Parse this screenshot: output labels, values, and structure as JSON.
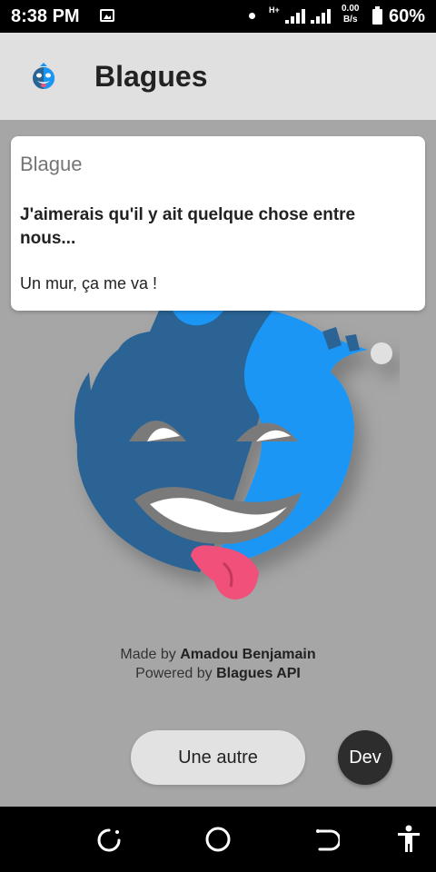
{
  "status_bar": {
    "time": "8:38 PM",
    "network": "H+",
    "speed_value": "0.00",
    "speed_unit": "B/s",
    "battery": "60%"
  },
  "app_bar": {
    "title": "Blagues",
    "logo_icon": "blague-mascot-icon"
  },
  "card": {
    "header": "Blague",
    "setup": "J'aimerais qu'il y ait quelque chose entre nous...",
    "punchline": "Un mur, ça me va !"
  },
  "credits": {
    "made_by_prefix": "Made by",
    "author": "Amadou Benjamain",
    "powered_by_prefix": "Powered by",
    "api": "Blagues API"
  },
  "buttons": {
    "another": "Une autre",
    "dev": "Dev"
  },
  "colors": {
    "light_blue": "#1a96f5",
    "dark_blue": "#2a6494",
    "tongue": "#f0507a",
    "background": "#a6a6a6"
  },
  "nav_bar": {
    "icons": [
      "recent-apps-icon",
      "home-icon",
      "back-icon",
      "accessibility-icon"
    ]
  }
}
